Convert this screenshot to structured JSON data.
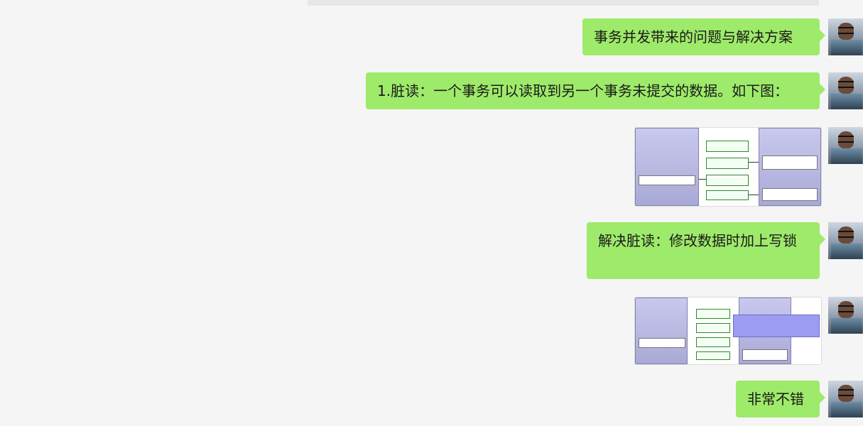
{
  "messages": [
    {
      "type": "text",
      "text": "事务并发带来的问题与解决方案"
    },
    {
      "type": "text",
      "text": "1.脏读：一个事务可以读取到另一个事务未提交的数据。如下图："
    },
    {
      "type": "image",
      "icon": "dirty-read-diagram"
    },
    {
      "type": "text",
      "text": "解决脏读：修改数据时加上写锁"
    },
    {
      "type": "image",
      "icon": "write-lock-diagram"
    },
    {
      "type": "text",
      "text": "非常不错"
    }
  ],
  "colors": {
    "bubble": "#9eea6a",
    "background": "#f5f5f5"
  }
}
